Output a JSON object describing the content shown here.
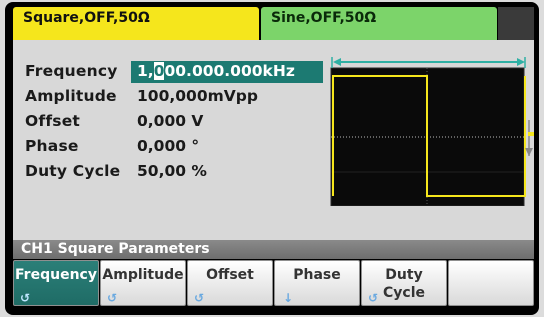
{
  "tabs": {
    "ch1": "Square,OFF,50Ω",
    "ch2": "Sine,OFF,50Ω"
  },
  "params": [
    {
      "label": "Frequency",
      "value_prefix": "1,",
      "value_cursor": "0",
      "value_rest": "00.000.000kHz"
    },
    {
      "label": "Amplitude",
      "value": "100,000mVpp"
    },
    {
      "label": "Offset",
      "value": "0,000 V"
    },
    {
      "label": "Phase",
      "value": "0,000 °"
    },
    {
      "label": "Duty Cycle",
      "value": "50,00 %"
    }
  ],
  "section_title": "CH1 Square Parameters",
  "softkeys": [
    {
      "line1": "Frequency",
      "line2": "",
      "icon": "knob-icon"
    },
    {
      "line1": "Amplitude",
      "line2": "",
      "icon": "knob-icon"
    },
    {
      "line1": "Offset",
      "line2": "",
      "icon": "knob-icon"
    },
    {
      "line1": "Phase",
      "line2": "",
      "icon": "down-arrow-icon"
    },
    {
      "line1": "Duty",
      "line2": "Cycle",
      "icon": "knob-icon"
    },
    {
      "line1": "",
      "line2": "",
      "icon": ""
    }
  ],
  "colors": {
    "ch1_tab": "#f5e61c",
    "ch2_tab": "#7cd46a",
    "selected_key": "#1f6c66",
    "waveform": "#f5e61c",
    "frequency_arrow": "#2fb0a4"
  }
}
